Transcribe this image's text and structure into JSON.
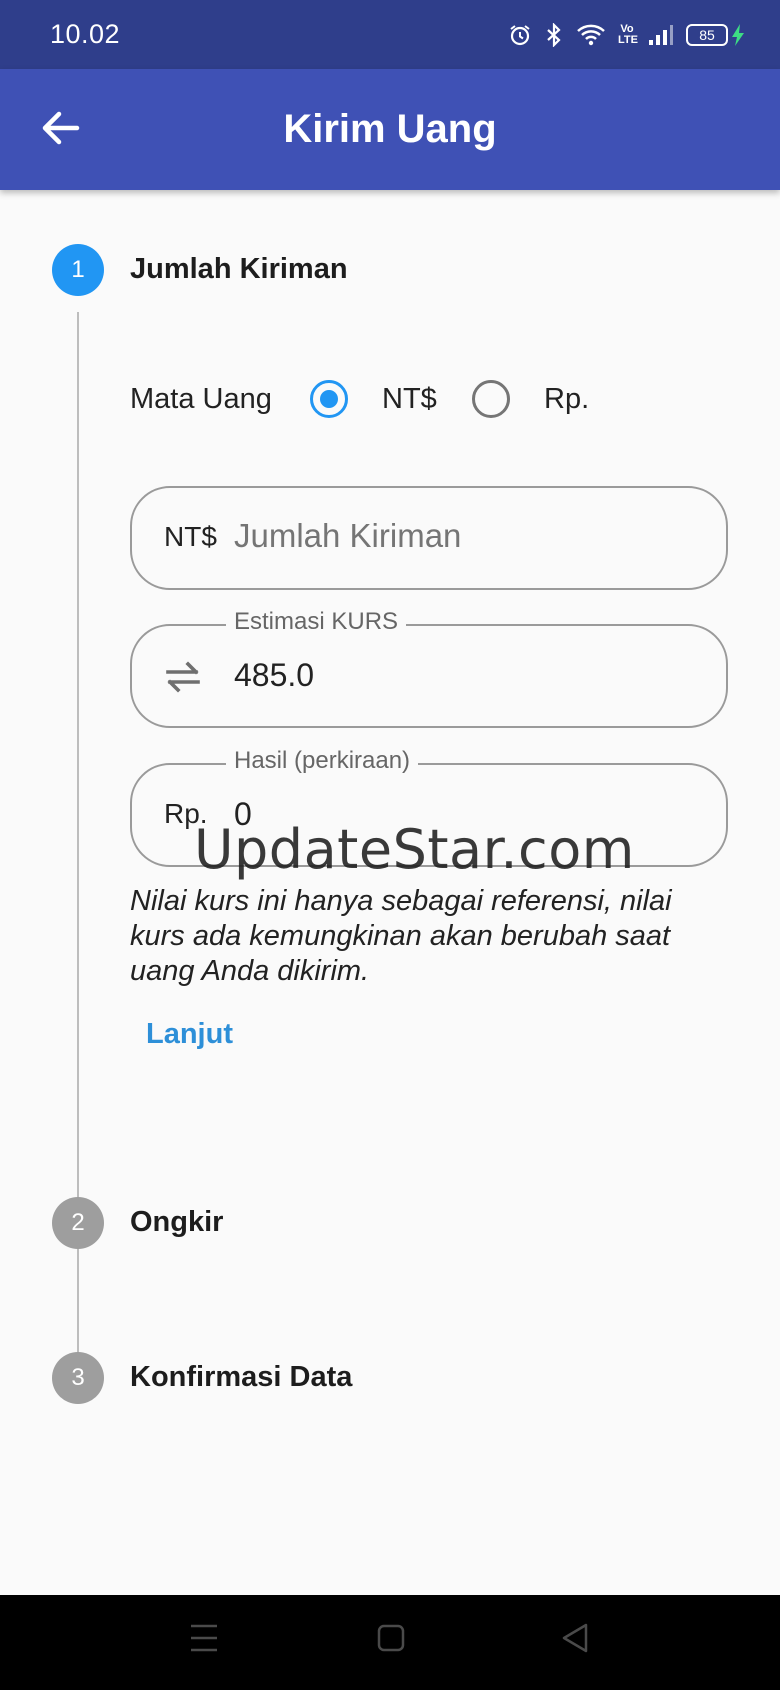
{
  "status_bar": {
    "time": "10.02",
    "network_label": "Vo LTE",
    "battery": "85"
  },
  "app_bar": {
    "title": "Kirim Uang"
  },
  "steps": [
    {
      "number": "1",
      "title": "Jumlah Kiriman",
      "state": "active"
    },
    {
      "number": "2",
      "title": "Ongkir",
      "state": "inactive"
    },
    {
      "number": "3",
      "title": "Konfirmasi Data",
      "state": "inactive"
    }
  ],
  "currency": {
    "label": "Mata Uang",
    "options": [
      {
        "label": "NT$",
        "selected": true
      },
      {
        "label": "Rp.",
        "selected": false
      }
    ]
  },
  "amount_field": {
    "prefix": "NT$",
    "value": "",
    "placeholder": "Jumlah Kiriman"
  },
  "rate_field": {
    "legend": "Estimasi KURS",
    "value": "485.0",
    "icon": "swap-icon"
  },
  "result_field": {
    "legend": "Hasil (perkiraan)",
    "prefix": "Rp.",
    "value": "0"
  },
  "note": "Nilai kurs ini hanya sebagai referensi, nilai kurs ada kemungkinan akan berubah saat uang Anda dikirim.",
  "next_button": "Lanjut",
  "watermark": "UpdateStar.com",
  "colors": {
    "status_bar": "#2f3e8b",
    "app_bar": "#3f51b5",
    "accent": "#2196f3",
    "link": "#2d8fd8",
    "inactive_step": "#9e9e9e"
  }
}
